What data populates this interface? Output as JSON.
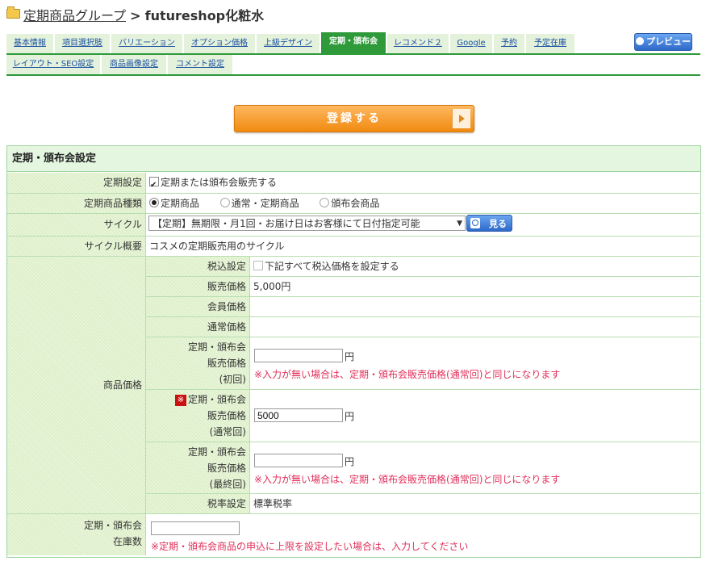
{
  "breadcrumb": {
    "parent": "定期商品グループ",
    "separator": ">",
    "current": "futureshop化粧水"
  },
  "tabs_row1": [
    "基本情報",
    "項目選択肢",
    "バリエーション",
    "オプション価格",
    "上級デザイン",
    "定期・頒布会",
    "レコメンド２",
    "Google",
    "予約",
    "予定在庫"
  ],
  "tabs_row2": [
    "レイアウト・SEO設定",
    "商品画像設定",
    "コメント設定"
  ],
  "active_tab": "定期・頒布会",
  "preview_label": "プレビュー",
  "register_label": "登録する",
  "section_title": "定期・頒布会設定",
  "rows": {
    "teiki_setting": {
      "label": "定期設定",
      "checkbox_label": "定期または頒布会販売する",
      "checked": true
    },
    "product_type": {
      "label": "定期商品種類",
      "options": [
        "定期商品",
        "通常・定期商品",
        "頒布会商品"
      ],
      "selected": "定期商品"
    },
    "cycle": {
      "label": "サイクル",
      "selected": "【定期】無期限・月1回・お届け日はお客様にて日付指定可能",
      "view_button": "見る"
    },
    "cycle_summary": {
      "label": "サイクル概要",
      "value": "コスメの定期販売用のサイクル"
    },
    "price": {
      "label": "商品価格",
      "tax_setting": {
        "label": "税込設定",
        "checkbox_label": "下記すべて税込価格を設定する",
        "checked": false
      },
      "sale_price": {
        "label": "販売価格",
        "value": "5,000円"
      },
      "member_price": {
        "label": "会員価格",
        "value": ""
      },
      "normal_price": {
        "label": "通常価格",
        "value": ""
      },
      "first": {
        "label_lines": [
          "定期・頒布会",
          "販売価格",
          "(初回)"
        ],
        "value": "",
        "unit": "円",
        "note": "※入力が無い場合は、定期・頒布会販売価格(通常回)と同じになります"
      },
      "regular": {
        "required_mark": "※",
        "label_lines": [
          "定期・頒布会",
          "販売価格",
          "(通常回)"
        ],
        "value": "5000",
        "unit": "円"
      },
      "final": {
        "label_lines": [
          "定期・頒布会",
          "販売価格",
          "(最終回)"
        ],
        "value": "",
        "unit": "円",
        "note": "※入力が無い場合は、定期・頒布会販売価格(通常回)と同じになります"
      },
      "tax_rate": {
        "label": "税率設定",
        "value": "標準税率"
      }
    },
    "stock": {
      "label_lines": [
        "定期・頒布会",
        "在庫数"
      ],
      "value": "",
      "note": "※定期・頒布会商品の申込に上限を設定したい場合は、入力してください"
    }
  },
  "colors": {
    "accent_green": "#2e9a3a",
    "label_bg": "#e8f5d8",
    "note_red": "#e0305a",
    "register_orange": "#f08a10"
  }
}
